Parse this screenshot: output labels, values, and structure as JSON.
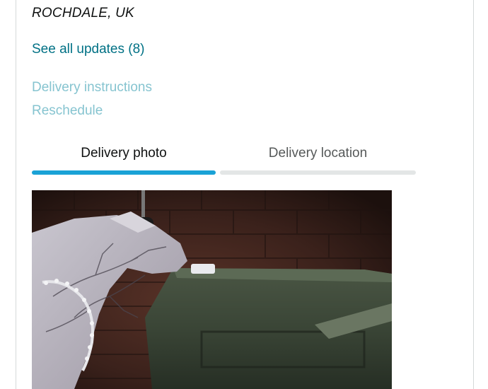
{
  "shipment": {
    "location": "ROCHDALE, UK",
    "see_all_updates": "See all updates (8)"
  },
  "actions": {
    "delivery_instructions": "Delivery instructions",
    "reschedule": "Reschedule"
  },
  "tabs": [
    {
      "label": "Delivery photo",
      "active": true
    },
    {
      "label": "Delivery location",
      "active": false
    }
  ],
  "colors": {
    "link": "#007185",
    "link_disabled": "#86c4d0",
    "active_tab": "#1aa2d6",
    "inactive_tab": "#e3e6e6"
  }
}
